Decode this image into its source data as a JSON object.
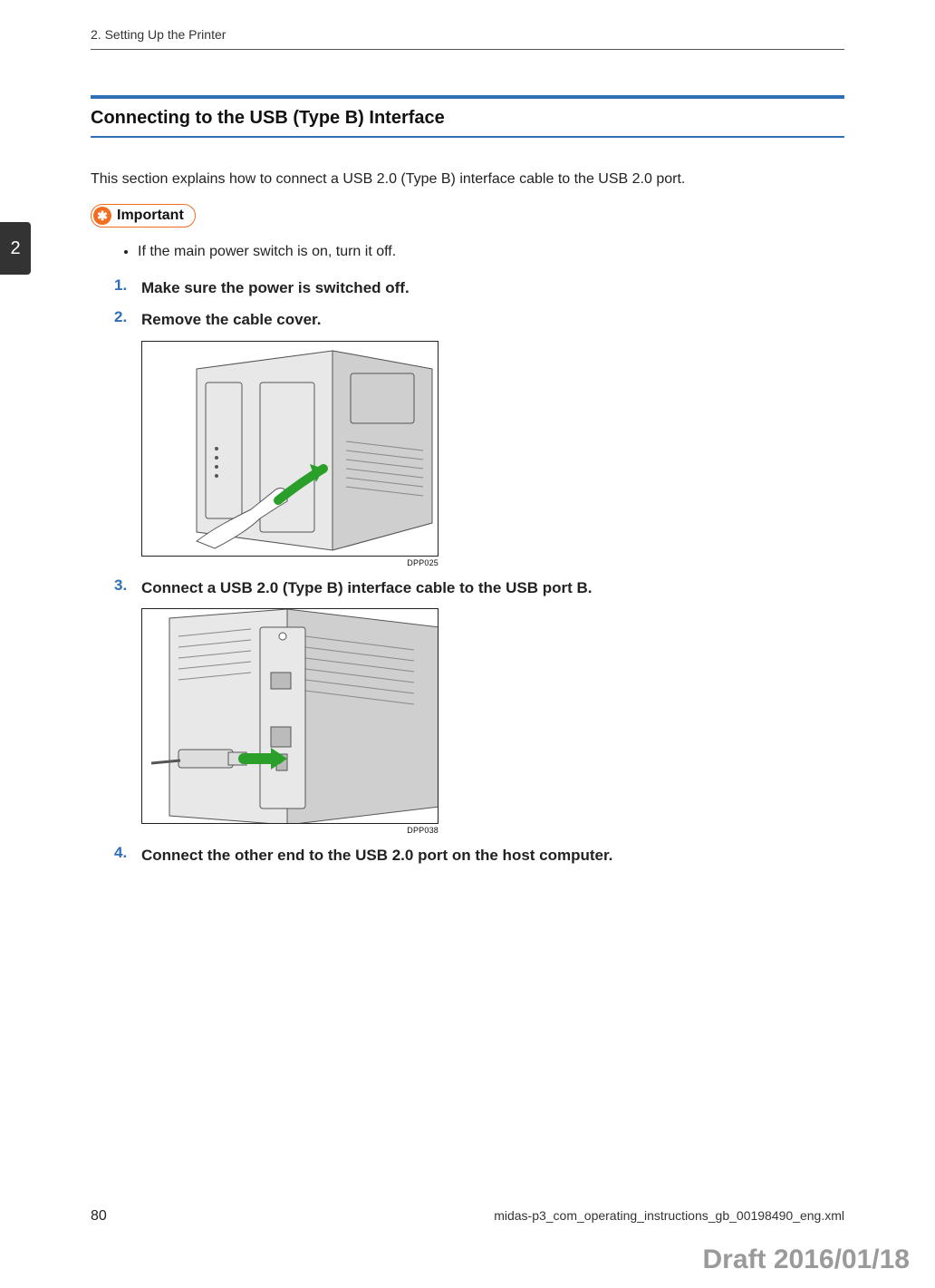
{
  "running_head": "2. Setting Up the Printer",
  "chapter_tab": "2",
  "section_title": "Connecting to the USB (Type B) Interface",
  "intro": "This section explains how to connect a USB 2.0 (Type B) interface cable to the USB 2.0 port.",
  "important_label": "Important",
  "important_items": [
    "If the main power switch is on, turn it off."
  ],
  "steps": [
    {
      "num": "1.",
      "text": "Make sure the power is switched off."
    },
    {
      "num": "2.",
      "text": "Remove the cable cover."
    },
    {
      "num": "3.",
      "text": "Connect a USB 2.0 (Type B) interface cable to the USB port B."
    },
    {
      "num": "4.",
      "text": "Connect the other end to the USB 2.0 port on the host computer."
    }
  ],
  "figures": {
    "fig1_caption": "DPP025",
    "fig2_caption": "DPP038"
  },
  "footer": {
    "page_number": "80",
    "filename": "midas-p3_com_operating_instructions_gb_00198490_eng.xml"
  },
  "draft_stamp": "Draft 2016/01/18"
}
